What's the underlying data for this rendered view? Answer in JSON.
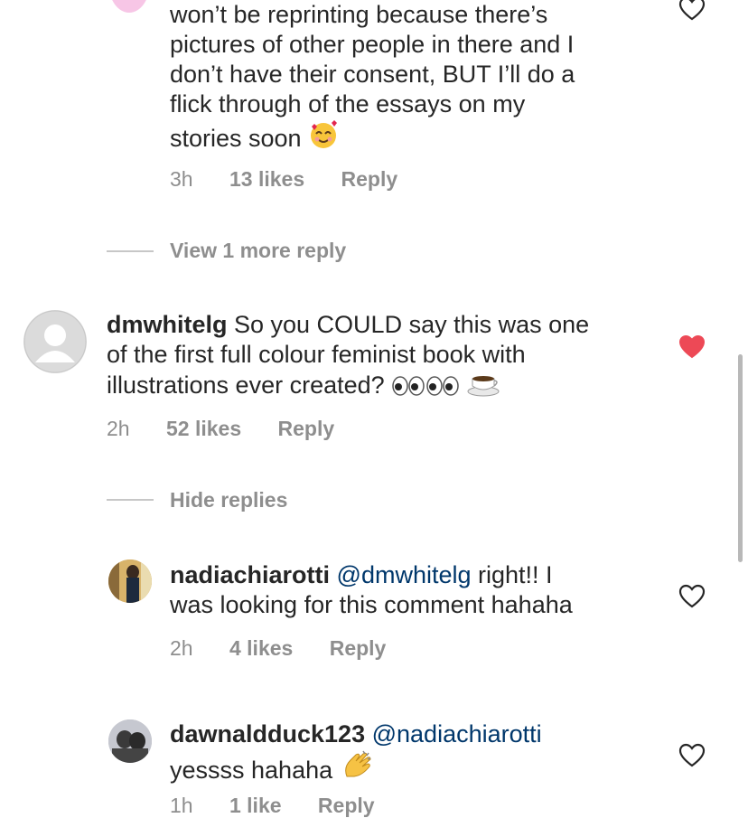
{
  "comments": [
    {
      "text_lines": [
        "won’t be reprinting because there’s",
        "pictures of other people in there and I",
        "don’t have their consent, BUT I’ll do a",
        "flick through of the essays on my",
        "stories soon"
      ],
      "emoji": "smiling-face-with-hearts",
      "time": "3h",
      "likes": "13 likes",
      "reply": "Reply",
      "liked": false
    },
    {
      "username": "dmwhitelg",
      "text_first": " So you COULD say this was one",
      "text_lines": [
        "of the first full colour feminist book with",
        "illustrations ever created?"
      ],
      "emoji": [
        "eyes",
        "eyes",
        "hot-beverage"
      ],
      "time": "2h",
      "likes": "52 likes",
      "reply": "Reply",
      "liked": true
    },
    {
      "username": "nadiachiarotti",
      "mention": "@dmwhitelg",
      "text_first": " right!! I",
      "text_lines": [
        "was looking for this comment hahaha"
      ],
      "time": "2h",
      "likes": "4 likes",
      "reply": "Reply",
      "liked": false
    },
    {
      "username": "dawnaldduck123",
      "mention": "@nadiachiarotti",
      "text_lines": [
        "yessss hahaha"
      ],
      "emoji": "clapping-hands",
      "time": "1h",
      "likes": "1 like",
      "reply": "Reply",
      "liked": false
    }
  ],
  "threads": {
    "view_more": "View 1 more reply",
    "hide": "Hide replies"
  },
  "colors": {
    "text": "#262626",
    "muted": "#8e8e8e",
    "mention": "#00376b",
    "like_red": "#ed4956"
  }
}
